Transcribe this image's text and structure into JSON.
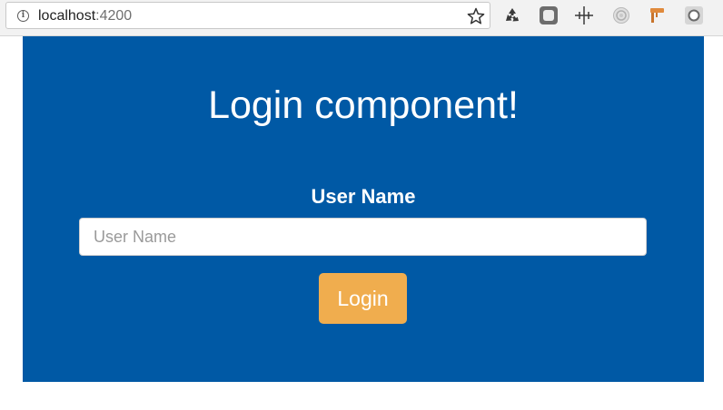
{
  "browser": {
    "url_host": "localhost",
    "url_port": ":4200",
    "icons": [
      "info-icon",
      "bookmark-star-icon",
      "recycle-extension-icon",
      "gray-square-extension-icon",
      "move-cross-extension-icon",
      "target-extension-icon",
      "paint-roller-extension-icon",
      "record-circle-extension-icon"
    ]
  },
  "page": {
    "background_color": "#0059a5",
    "title": "Login component!",
    "username_label": "User Name",
    "username_placeholder": "User Name",
    "username_value": "",
    "login_button_label": "Login",
    "login_button_color": "#f0ad4e"
  }
}
